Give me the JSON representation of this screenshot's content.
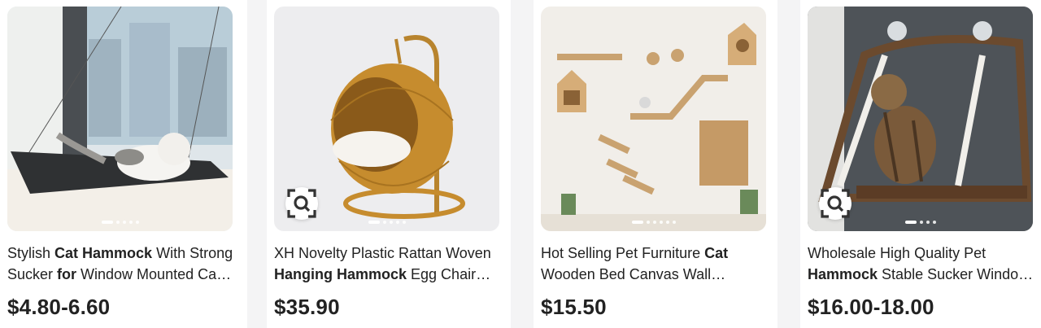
{
  "products": [
    {
      "title_parts": [
        {
          "text": "Stylish ",
          "bold": false
        },
        {
          "text": "Cat Hammock",
          "bold": true
        },
        {
          "text": " With Strong Sucker ",
          "bold": false
        },
        {
          "text": "for",
          "bold": true
        },
        {
          "text": " Window Mounted Cat Bed",
          "bold": false
        }
      ],
      "price": "$4.80-6.60",
      "has_image_search": false,
      "carousel_dots": 5
    },
    {
      "title_parts": [
        {
          "text": "XH Novelty Plastic Rattan Woven ",
          "bold": false
        },
        {
          "text": "Hanging Hammock",
          "bold": true
        },
        {
          "text": " Egg Chair Basket",
          "bold": false
        }
      ],
      "price": "$35.90",
      "has_image_search": true,
      "carousel_dots": 5
    },
    {
      "title_parts": [
        {
          "text": "Hot Selling Pet Furniture ",
          "bold": false
        },
        {
          "text": "Cat",
          "bold": true
        },
        {
          "text": " Wooden Bed Canvas Wall Mounted Climbing",
          "bold": false
        }
      ],
      "price": "$15.50",
      "has_image_search": false,
      "carousel_dots": 6
    },
    {
      "title_parts": [
        {
          "text": "Wholesale High Quality Pet ",
          "bold": false
        },
        {
          "text": "Hammock",
          "bold": true
        },
        {
          "text": " Stable Sucker Window Cat Bed",
          "bold": false
        }
      ],
      "price": "$16.00-18.00",
      "has_image_search": true,
      "carousel_dots": 4
    }
  ],
  "icons": {
    "image_search": "image-search-icon"
  }
}
